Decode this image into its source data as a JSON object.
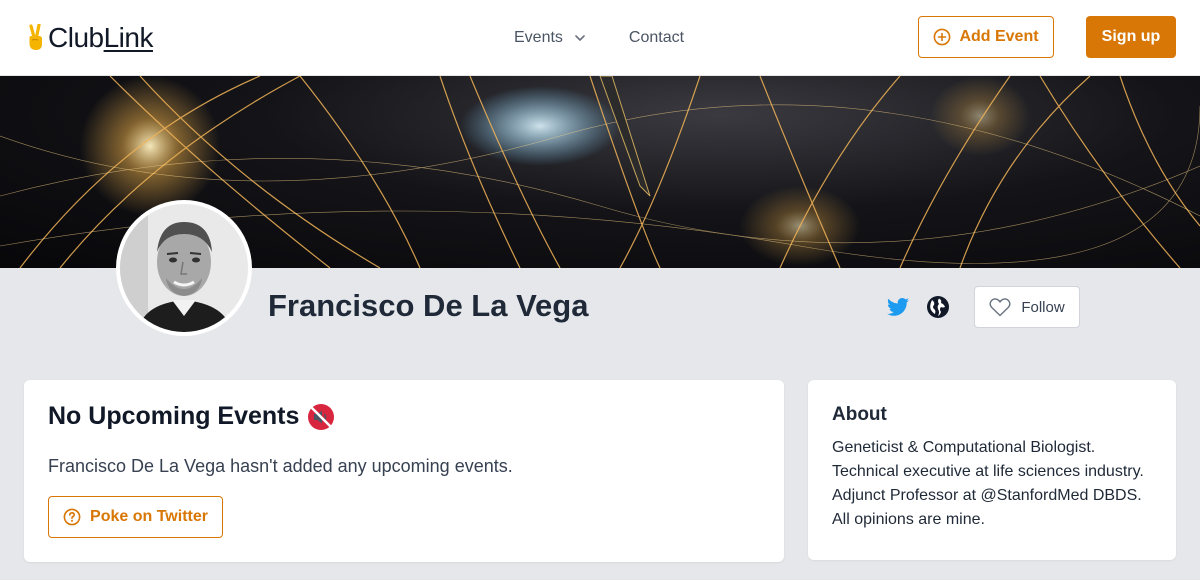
{
  "brand": {
    "name_prefix": "Club",
    "name_suffix": "Link",
    "accent_color": "#d97706"
  },
  "nav": {
    "events_label": "Events",
    "contact_label": "Contact",
    "add_event_label": "Add Event",
    "signup_label": "Sign up"
  },
  "profile": {
    "name": "Francisco De La Vega",
    "follow_label": "Follow",
    "links": [
      "twitter-icon",
      "globe-icon"
    ]
  },
  "events_card": {
    "title": "No Upcoming Events",
    "title_emoji": "mute-speaker-icon",
    "message": "Francisco De La Vega hasn't added any upcoming events.",
    "poke_label": "Poke on Twitter"
  },
  "about_card": {
    "title": "About",
    "lines": [
      "Geneticist & Computational Biologist.",
      "Technical executive at life sciences industry.",
      "Adjunct Professor at @StanfordMed DBDS.",
      "All opinions are mine."
    ]
  }
}
